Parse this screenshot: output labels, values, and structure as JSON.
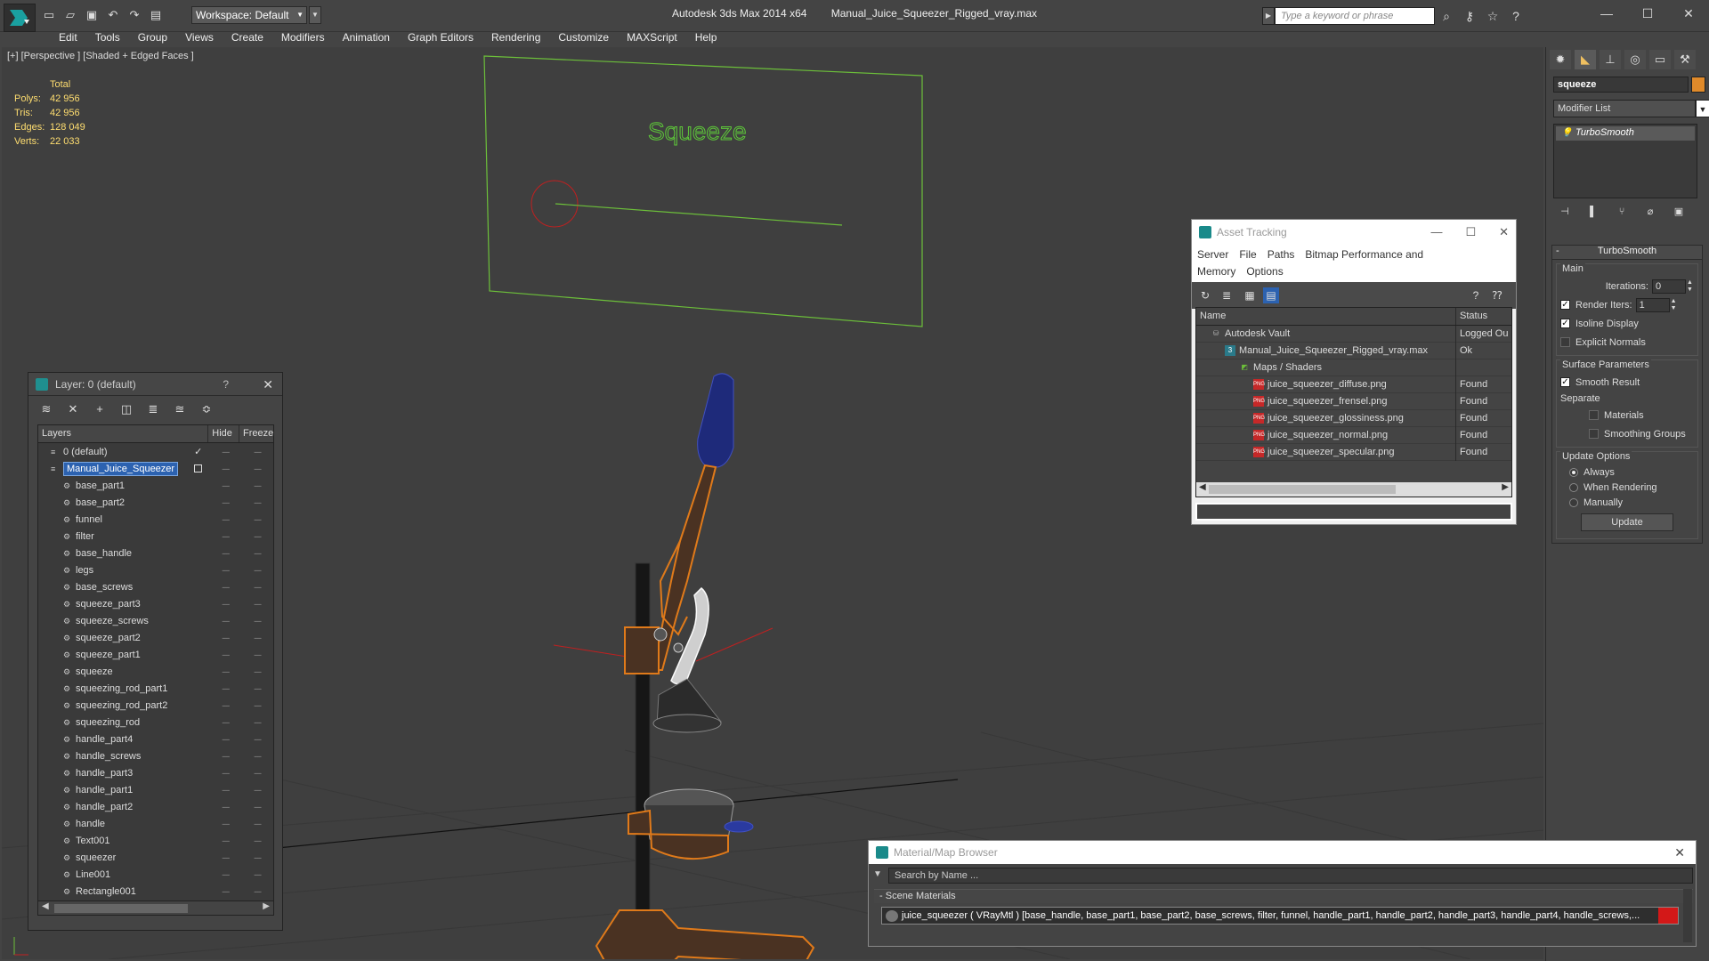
{
  "window": {
    "app_title": "Autodesk 3ds Max  2014 x64",
    "file_name": "Manual_Juice_Squeezer_Rigged_vray.max",
    "workspace": "Workspace: Default",
    "search_placeholder": "Type a keyword or phrase"
  },
  "menu": [
    "Edit",
    "Tools",
    "Group",
    "Views",
    "Create",
    "Modifiers",
    "Animation",
    "Graph Editors",
    "Rendering",
    "Customize",
    "MAXScript",
    "Help"
  ],
  "viewport": {
    "label": "[+] [Perspective ] [Shaded + Edged Faces ]",
    "text_object": "Squeeze",
    "stats": {
      "header": "Total",
      "rows": [
        {
          "k": "Polys:",
          "v": "42 956"
        },
        {
          "k": "Tris:",
          "v": "42 956"
        },
        {
          "k": "Edges:",
          "v": "128 049"
        },
        {
          "k": "Verts:",
          "v": "22 033"
        }
      ]
    }
  },
  "layer_dialog": {
    "title": "Layer: 0 (default)",
    "help": "?",
    "columns": [
      "Layers",
      "Hide",
      "Freeze"
    ],
    "rows": [
      {
        "name": "0 (default)",
        "level": 0,
        "check": "✓"
      },
      {
        "name": "Manual_Juice_Squeezer",
        "level": 0,
        "selected": true
      },
      {
        "name": "base_part1",
        "level": 1
      },
      {
        "name": "base_part2",
        "level": 1
      },
      {
        "name": "funnel",
        "level": 1
      },
      {
        "name": "filter",
        "level": 1
      },
      {
        "name": "base_handle",
        "level": 1
      },
      {
        "name": "legs",
        "level": 1
      },
      {
        "name": "base_screws",
        "level": 1
      },
      {
        "name": "squeeze_part3",
        "level": 1
      },
      {
        "name": "squeeze_screws",
        "level": 1
      },
      {
        "name": "squeeze_part2",
        "level": 1
      },
      {
        "name": "squeeze_part1",
        "level": 1
      },
      {
        "name": "squeeze",
        "level": 1
      },
      {
        "name": "squeezing_rod_part1",
        "level": 1
      },
      {
        "name": "squeezing_rod_part2",
        "level": 1
      },
      {
        "name": "squeezing_rod",
        "level": 1
      },
      {
        "name": "handle_part4",
        "level": 1
      },
      {
        "name": "handle_screws",
        "level": 1
      },
      {
        "name": "handle_part3",
        "level": 1
      },
      {
        "name": "handle_part1",
        "level": 1
      },
      {
        "name": "handle_part2",
        "level": 1
      },
      {
        "name": "handle",
        "level": 1
      },
      {
        "name": "Text001",
        "level": 1
      },
      {
        "name": "squeezer",
        "level": 1
      },
      {
        "name": "Line001",
        "level": 1
      },
      {
        "name": "Rectangle001",
        "level": 1
      }
    ]
  },
  "asset_tracking": {
    "title": "Asset Tracking",
    "menu": [
      "Server",
      "File",
      "Paths",
      "Bitmap Performance and Memory",
      "Options"
    ],
    "columns": [
      "Name",
      "Status"
    ],
    "rows": [
      {
        "name": "Autodesk Vault",
        "status": "Logged Ou",
        "indent": 1,
        "icon": "vault"
      },
      {
        "name": "Manual_Juice_Squeezer_Rigged_vray.max",
        "status": "Ok",
        "indent": 2,
        "icon": "max"
      },
      {
        "name": "Maps / Shaders",
        "status": "",
        "indent": 3,
        "icon": "maps"
      },
      {
        "name": "juice_squeezer_diffuse.png",
        "status": "Found",
        "indent": 4,
        "icon": "png"
      },
      {
        "name": "juice_squeezer_frensel.png",
        "status": "Found",
        "indent": 4,
        "icon": "png"
      },
      {
        "name": "juice_squeezer_glossiness.png",
        "status": "Found",
        "indent": 4,
        "icon": "png"
      },
      {
        "name": "juice_squeezer_normal.png",
        "status": "Found",
        "indent": 4,
        "icon": "png"
      },
      {
        "name": "juice_squeezer_specular.png",
        "status": "Found",
        "indent": 4,
        "icon": "png"
      }
    ]
  },
  "command_panel": {
    "object_name": "squeeze",
    "object_color": "#e08a2a",
    "modifier_list": "Modifier List",
    "stack": [
      "TurboSmooth"
    ],
    "rollout_title": "TurboSmooth",
    "main_label": "Main",
    "iterations_label": "Iterations:",
    "iterations_value": "0",
    "render_iters_label": "Render Iters:",
    "render_iters_value": "1",
    "isoline_display": "Isoline Display",
    "explicit_normals": "Explicit Normals",
    "surface_params_label": "Surface Parameters",
    "smooth_result": "Smooth Result",
    "separate_label": "Separate",
    "materials": "Materials",
    "smoothing_groups": "Smoothing Groups",
    "update_options_label": "Update Options",
    "always": "Always",
    "when_rendering": "When Rendering",
    "manually": "Manually",
    "update_button": "Update"
  },
  "material_browser": {
    "title": "Material/Map Browser",
    "search_placeholder": "Search by Name ...",
    "section": "Scene Materials",
    "material_row": "juice_squeezer  ( VRayMtl )  [base_handle, base_part1, base_part2, base_screws, filter, funnel, handle_part1, handle_part2, handle_part3, handle_part4, handle_screws,..."
  },
  "colors": {
    "wire_orange": "#e07a1a",
    "wire_white": "#f0f0f0",
    "wire_blue": "#2a3aa0",
    "text_green": "#5ec83a",
    "accent_blue": "#2c62b0",
    "stats_yellow": "#ffde70"
  }
}
